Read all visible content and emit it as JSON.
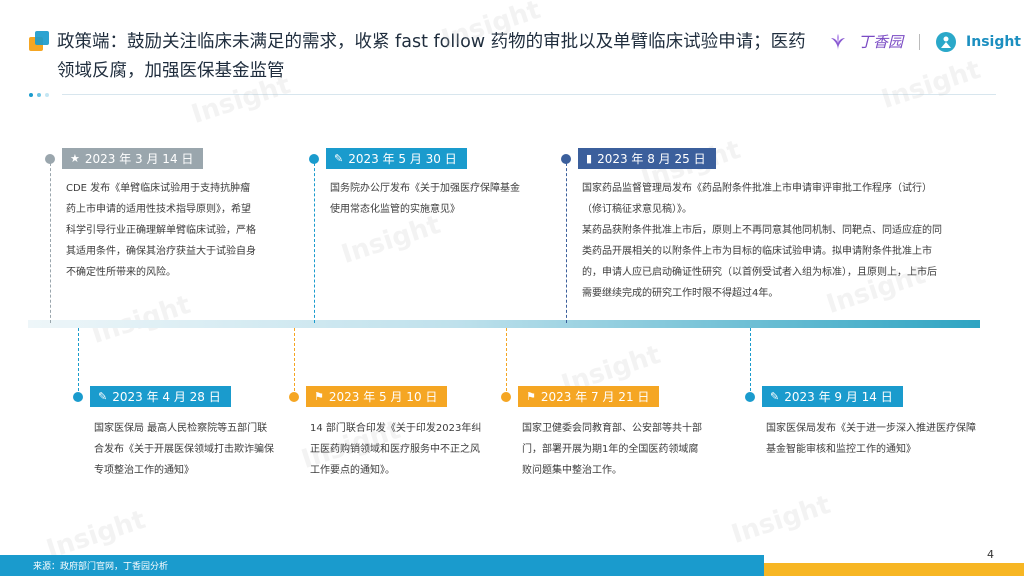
{
  "header": {
    "title": "政策端：鼓励关注临床未满足的需求，收紧 fast follow 药物的审批以及单臂临床试验申请；医药领域反腐，加强医保基金监管",
    "brand_dx": "丁香园",
    "brand_insight": "Insight"
  },
  "watermark": "Insight",
  "colors": {
    "teal": "#1a9bcd",
    "gray": "#9aa6ad",
    "orange": "#f5a623",
    "navy": "#3b5f9c"
  },
  "events_top": [
    {
      "date": "2023 年 3 月 14 日",
      "icon": "star-icon",
      "text": "CDE 发布《单臂临床试验用于支持抗肿瘤药上市申请的适用性技术指导原则》，希望科学引导行业正确理解单臂临床试验，严格其适用条件，确保其治疗获益大于试验自身不确定性所带来的风险。"
    },
    {
      "date": "2023 年 5 月 30 日",
      "icon": "pin-icon",
      "text": "国务院办公厅发布《关于加强医疗保障基金使用常态化监管的实施意见》"
    },
    {
      "date": "2023 年 8 月 25 日",
      "icon": "bookmark-icon",
      "text": "国家药品监督管理局发布《药品附条件批准上市申请审评审批工作程序（试行）（修订稿征求意见稿）》。\n某药品获附条件批准上市后，原则上不再同意其他同机制、同靶点、同适应症的同类药品开展相关的以附条件上市为目标的临床试验申请。拟申请附条件批准上市的，申请人应已启动确证性研究（以首例受试者入组为标准），且原则上，上市后需要继续完成的研究工作时限不得超过4年。"
    }
  ],
  "events_bottom": [
    {
      "date": "2023 年 4 月 28 日",
      "icon": "pin-icon",
      "text": "国家医保局  最高人民检察院等五部门联合发布《关于开展医保领域打击欺诈骗保专项整治工作的通知》"
    },
    {
      "date": "2023 年 5 月 10 日",
      "icon": "flag-icon",
      "text": "14 部门联合印发《关于印发2023年纠正医药购销领域和医疗服务中不正之风工作要点的通知》。"
    },
    {
      "date": "2023 年 7 月 21 日",
      "icon": "flag-icon",
      "text": "国家卫健委会同教育部、公安部等共十部门，部署开展为期1年的全国医药领域腐败问题集中整治工作。"
    },
    {
      "date": "2023 年 9 月 14 日",
      "icon": "pin-icon",
      "text": "国家医保局发布《关于进一步深入推进医疗保障基金智能审核和监控工作的通知》"
    }
  ],
  "footer": {
    "source": "来源：政府部门官网，丁香园分析",
    "page": "4"
  }
}
